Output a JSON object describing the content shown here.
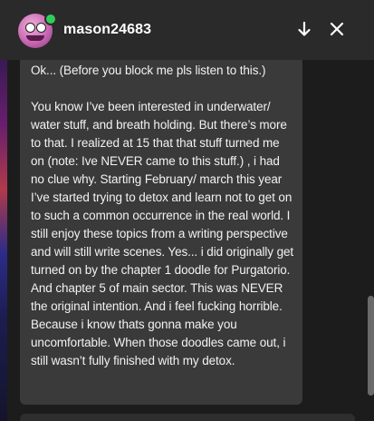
{
  "header": {
    "username": "mason24683"
  },
  "icons": {
    "avatar": "avatar",
    "online": "online-status",
    "down": "arrow-down-icon",
    "close": "close-icon"
  },
  "colors": {
    "online_dot": "#2fce5a",
    "bubble_bg": "#3a3a3a",
    "header_bg": "#2a2a2a"
  },
  "message": {
    "line1": "Ok... (Before you block me pls listen to this.)",
    "body": "You know I’ve been interested in underwater/ water stuff, and breath holding. But there’s more to that. I realized at 15 that that stuff turned me on (note: Ive NEVER came to this stuff.) , i had no clue why. Starting February/ march this year I’ve started trying to detox and learn not to get on to such a common occurrence in the real world. I still enjoy these topics from a writing perspective and will still write scenes. Yes... i did originally get turned on by the chapter 1 doodle for Purgatorio. And chapter 5 of main sector. This was NEVER the original intention. And i feel fucking horrible. Because i know thats gonna make you uncomfortable. When those doodles came out, i still wasn’t fully finished with my detox."
  }
}
